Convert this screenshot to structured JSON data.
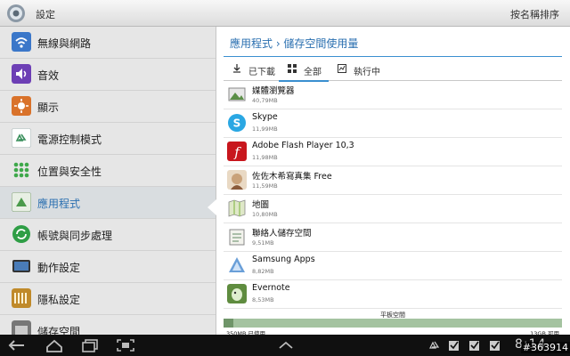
{
  "header": {
    "title": "設定",
    "sort_label": "按名稱排序"
  },
  "sidebar": {
    "items": [
      {
        "label": "無線與網路",
        "icon": "wifi-icon",
        "color": "#3b77c9"
      },
      {
        "label": "音效",
        "icon": "speaker-icon",
        "color": "#6d3fb5"
      },
      {
        "label": "顯示",
        "icon": "brightness-icon",
        "color": "#d9722a"
      },
      {
        "label": "電源控制模式",
        "icon": "recycle-icon",
        "color": "#3a8f5c"
      },
      {
        "label": "位置與安全性",
        "icon": "location-grid-icon",
        "color": "#3ea84a"
      },
      {
        "label": "應用程式",
        "icon": "apps-icon",
        "color": "#4a9a4a",
        "active": true
      },
      {
        "label": "帳號與同步處理",
        "icon": "sync-icon",
        "color": "#2f9e46"
      },
      {
        "label": "動作設定",
        "icon": "tablet-motion-icon",
        "color": "#4a7cb8"
      },
      {
        "label": "隱私設定",
        "icon": "privacy-icon",
        "color": "#c08a2a"
      },
      {
        "label": "儲存空間",
        "icon": "storage-icon",
        "color": "#777777"
      }
    ]
  },
  "main": {
    "breadcrumb": "應用程式 › 儲存空間使用量",
    "tabs": [
      {
        "label": "已下載",
        "icon": "download-icon"
      },
      {
        "label": "全部",
        "icon": "grid-icon",
        "selected": true
      },
      {
        "label": "執行中",
        "icon": "running-icon"
      }
    ],
    "apps": [
      {
        "name": "媒體瀏覽器",
        "size": "40,79MB",
        "icon": "media-browser-icon",
        "color": "#5b8f47"
      },
      {
        "name": "Skype",
        "size": "11,99MB",
        "icon": "skype-icon",
        "color": "#2aa7e3"
      },
      {
        "name": "Adobe Flash Player 10,3",
        "size": "11,98MB",
        "icon": "flash-icon",
        "color": "#c8161d"
      },
      {
        "name": "佐佐木希寫真集 Free",
        "size": "11,59MB",
        "icon": "photo-book-icon",
        "color": "#c9a27a"
      },
      {
        "name": "地圖",
        "size": "10,80MB",
        "icon": "maps-icon",
        "color": "#9cc46a"
      },
      {
        "name": "聯絡人儲存空間",
        "size": "9,51MB",
        "icon": "contacts-storage-icon",
        "color": "#7f9f7f"
      },
      {
        "name": "Samsung Apps",
        "size": "8,82MB",
        "icon": "samsung-apps-icon",
        "color": "#6a9fd8"
      },
      {
        "name": "Evernote",
        "size": "8,53MB",
        "icon": "evernote-icon",
        "color": "#5f8c3f"
      }
    ],
    "storage": {
      "label": "平板空間",
      "used": "350MB 已使用",
      "free": "13GB 可用",
      "used_fraction": 0.03
    }
  },
  "statusbar": {
    "time": "8:14",
    "watermark": "#363914"
  }
}
